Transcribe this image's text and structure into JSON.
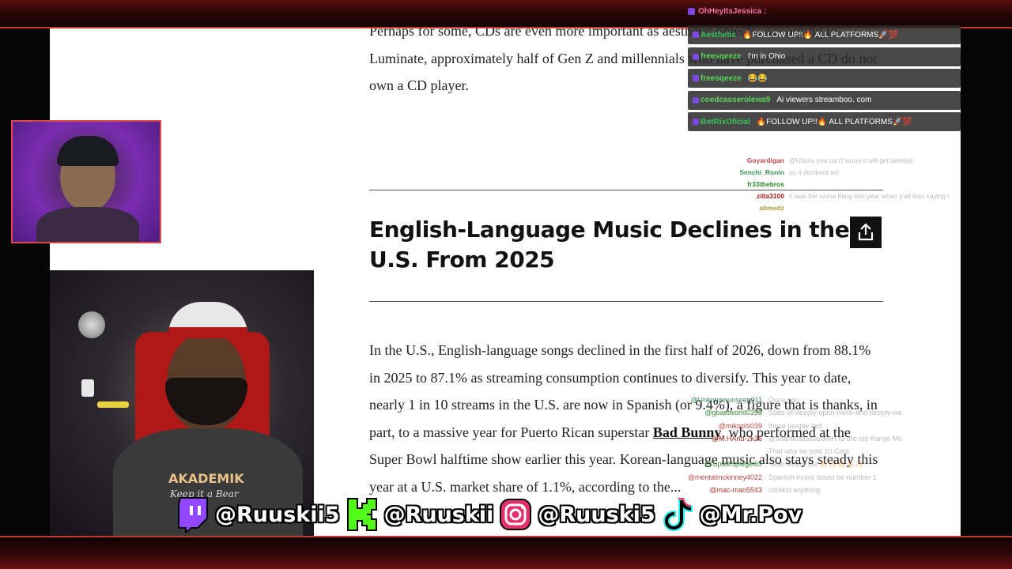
{
  "article": {
    "top_paragraph": "Perhaps for some, CDs are even more important as aesthetic objects. According to Luminate, approximately half of Gen Z and millennials who have purchased a CD do not own a CD player.",
    "headline": "English-Language Music Declines in the U.S. From 2025",
    "paragraph_before_link": "In the U.S., English-language songs declined in the first half of 2026, down from 88.1% in 2025 to 87.1% as streaming consumption continues to diversify. This year to date, nearly 1 in 10 streams in the U.S. are now in Spanish (or 9.4%), a figure that is thanks, in part, to a massive year for Puerto Rican superstar ",
    "link_text": "Bad Bunny",
    "paragraph_after_link": ", who performed at the Super Bowl halftime show earlier this year. Korean-language music also stays steady this year at a U.S. market share of 1.1%, according to the..."
  },
  "share_icon": "share-icon",
  "chat_top": {
    "pinned": {
      "user": "OhHeyItsJessica :",
      "color": "#ff6fa8"
    },
    "messages": [
      {
        "user": "Aesthetic",
        "color": "#37c35d",
        "text": "🔥FOLLOW UP!!🔥 ALL PLATFORMS🚀💯"
      },
      {
        "user": "freesqeeze",
        "color": "#5bd35b",
        "text": "I'm in Ohio"
      },
      {
        "user": "freesqeeze",
        "color": "#5bd35b",
        "text": "😂😂"
      },
      {
        "user": "coedcasserolewa9",
        "color": "#5bd35b",
        "text": "Ai viewers streamboo. com"
      },
      {
        "user": "BotRixOficial",
        "color": "#37c35d",
        "text": "🔥FOLLOW UP!!🔥 ALL PLATFORMS🚀💯"
      }
    ]
  },
  "faded_chat": [
    {
      "user": "Goyardigan",
      "color": "#c04a4a",
      "text": "@Uliahs you can't wooo it will get deleted"
    },
    {
      "user": "Senchi_Ronin",
      "color": "#3a9a5a",
      "text": "so it declined sol"
    },
    {
      "user": "fr33thebros",
      "color": "#2a8a2a",
      "text": ""
    },
    {
      "user": "zilla3100",
      "color": "#b02020",
      "text": "it was the same thing last year when y'all was saying it's dead"
    },
    {
      "user": "ahmedz",
      "color": "#a0a040",
      "text": ""
    }
  ],
  "faded_chat_bottom": [
    {
      "user": "@Unknownunseen911",
      "color": "#3a8a5a",
      "text": "Once you"
    },
    {
      "user": "@gbastworld0353",
      "color": "#3a8a3a",
      "text": "Stats-of-deeply-open-more-and-deeply-wear"
    },
    {
      "user": "@mikophi039",
      "color": "#c04a4a",
      "text": "those people lied"
    },
    {
      "user": "@M.HAnd-2k26",
      "color": "#b03a2a",
      "text": "@shanikiaftawardMH IS the old Kanye Mass"
    },
    {
      "user": "",
      "color": "#888",
      "text": "That why he sold 10 Cent"
    },
    {
      "user": "@SpikeSpiegel69",
      "color": "#3a8a3a",
      "text": "Yeah album fire 🔥🔥🔥🔥🔥"
    },
    {
      "user": "@mentalmckinney4022",
      "color": "#c04a4a",
      "text": "Spanish music bouta be number 1"
    },
    {
      "user": "@mac-man5543",
      "color": "#b03a2a",
      "text": "coolest anything"
    }
  ],
  "socials": [
    {
      "icon": "twitch-icon",
      "handle": "@Ruuskii5",
      "color": "#9146ff"
    },
    {
      "icon": "kick-icon",
      "handle": "@Ruuskii",
      "color": "#53fc18"
    },
    {
      "icon": "instagram-icon",
      "handle": "@Ruuski5",
      "color": "#e1306c"
    },
    {
      "icon": "tiktok-icon",
      "handle": "@Mr.Pov",
      "color": "#ffffff"
    }
  ],
  "webcam_main": {
    "shirt_text": "AKADEMIK",
    "shirt_sub": "Keep it a Bear"
  }
}
